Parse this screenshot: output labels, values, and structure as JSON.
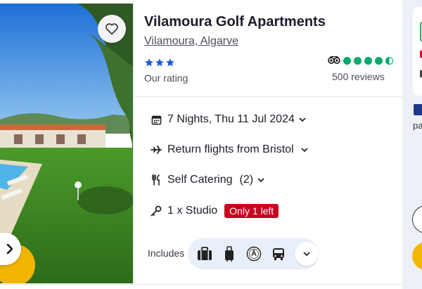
{
  "hotel": {
    "name": "Vilamoura Golf Apartments",
    "location": "Vilamoura, Algarve",
    "star_count": 3,
    "rating_label": "Our rating",
    "tripadvisor_score": 4.5,
    "reviews_label": "500 reviews"
  },
  "details": {
    "dates": "7 Nights, Thu 11 Jul 2024",
    "flights": "Return flights from Bristol",
    "board": "Self Catering",
    "board_count": "(2)",
    "room": "1 x Studio",
    "availability_badge": "Only 1 left"
  },
  "includes": {
    "label": "Includes",
    "items": [
      "luggage-icon",
      "hand-luggage-icon",
      "atol-protection-icon",
      "transfer-bus-icon"
    ]
  },
  "right_panel": {
    "partial_text": "pa"
  },
  "colors": {
    "star": "#1a5bd6",
    "tripadvisor_green": "#00aa6c",
    "badge_red": "#c9001e",
    "includes_pill": "#e8eefa",
    "right_panel_bg": "#edf1f7",
    "accent_yellow": "#f5b800"
  }
}
